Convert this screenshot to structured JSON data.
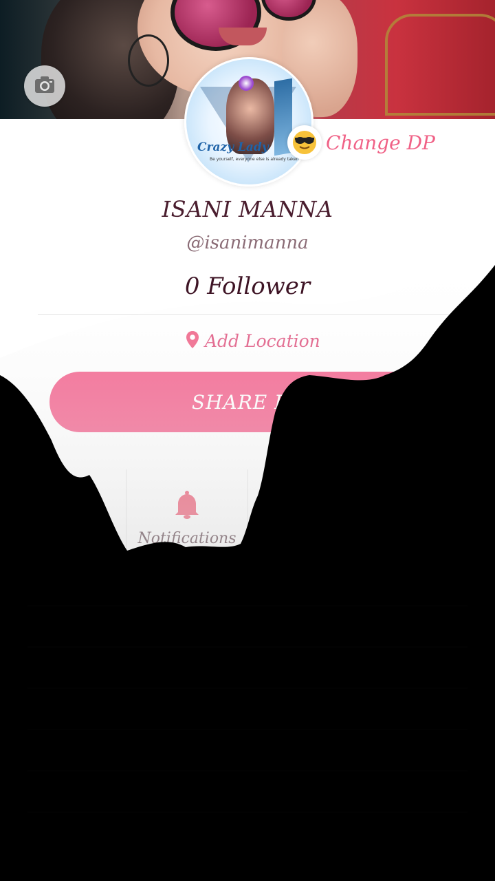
{
  "profile": {
    "name": "ISANI MANNA",
    "handle": "@isanimanna",
    "followers_text": "0 Follower",
    "avatar": {
      "brand": "Crazy Lady",
      "tagline": "Be yourself, everyone else is already taken"
    }
  },
  "actions": {
    "change_dp_label": "Change DP",
    "change_dp_emoji": "😎",
    "location_label": "Add Location",
    "share_label": "SHARE PR"
  },
  "menu": {
    "items": [
      {
        "label": "Notifications",
        "icon": "bell-icon"
      }
    ]
  },
  "icons": {
    "camera": "camera-icon",
    "location": "location-pin-icon"
  },
  "colors": {
    "accent": "#f45d8a",
    "location": "#e05580",
    "name": "#4a1d2e"
  }
}
